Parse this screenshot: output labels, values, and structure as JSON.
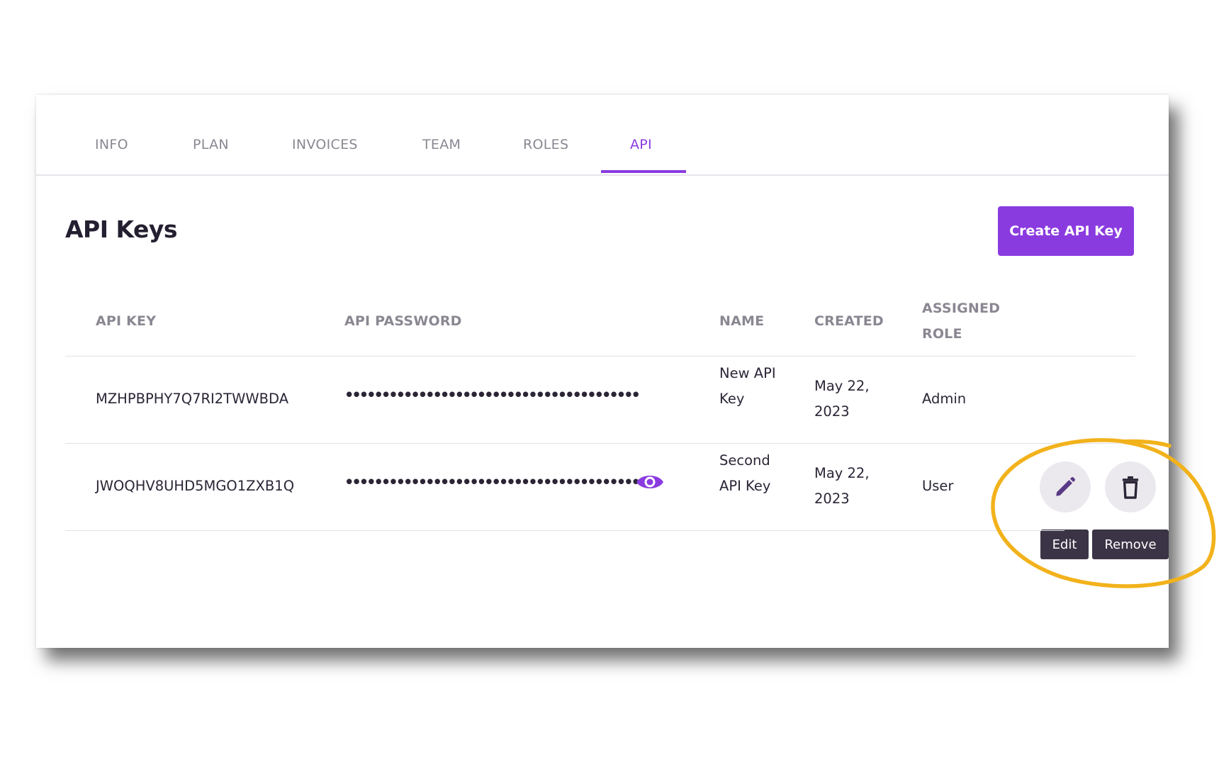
{
  "tabs": [
    {
      "label": "INFO"
    },
    {
      "label": "PLAN"
    },
    {
      "label": "INVOICES"
    },
    {
      "label": "TEAM"
    },
    {
      "label": "ROLES"
    },
    {
      "label": "API"
    }
  ],
  "active_tab": "API",
  "page_title": "API Keys",
  "create_button_label": "Create API Key",
  "table": {
    "headers": {
      "api_key": "API KEY",
      "api_password": "API PASSWORD",
      "name": "NAME",
      "created": "CREATED",
      "assigned_role": "ASSIGNED ROLE"
    },
    "rows": [
      {
        "api_key": "MZHPBPHY7Q7RI2TWWBDA",
        "api_password": "••••••••••••••••••••••••••••••••••••••••",
        "name": "New API Key",
        "created": "May 22, 2023",
        "assigned_role": "Admin"
      },
      {
        "api_key": "JWOQHV8UHD5MGO1ZXB1Q",
        "api_password": "••••••••••••••••••••••••••••••••••••••••",
        "name": "Second API Key",
        "created": "May 22, 2023",
        "assigned_role": "User"
      }
    ]
  },
  "row_actions": {
    "edit_tooltip": "Edit",
    "remove_tooltip": "Remove"
  },
  "icons": {
    "reveal": "eye-icon",
    "edit": "pencil-icon",
    "remove": "trash-icon"
  },
  "colors": {
    "accent": "#8a3be0",
    "highlight_annotation": "#f2b21b",
    "tooltip_bg": "#3b3446"
  }
}
